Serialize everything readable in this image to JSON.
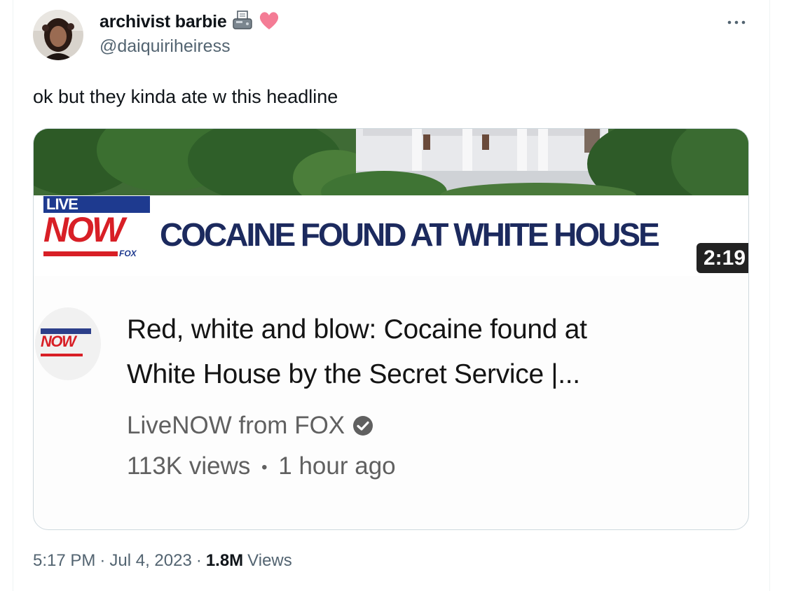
{
  "author": {
    "display_name": "archivist barbie",
    "handle": "@daiquiriheiress",
    "name_emojis": [
      "fax-machine-icon",
      "pink-heart-icon"
    ]
  },
  "menu_icon": "more-horizontal-icon",
  "tweet": {
    "text": "ok but they kinda ate w this headline"
  },
  "card": {
    "thumbnail": {
      "logo_live": "LIVE",
      "logo_now": "NOW",
      "logo_fox": "FOX",
      "headline": "COCAINE FOUND AT WHITE HOUSE",
      "duration": "2:19"
    },
    "channel_avatar_text": "NOW",
    "video_title_line1": "Red, white and blow: Cocaine found at",
    "video_title_line2": "White House by the Secret Service |...",
    "channel_name": "LiveNOW from FOX",
    "views": "113K views",
    "separator": "•",
    "age": "1 hour ago"
  },
  "footer": {
    "time": "5:17 PM",
    "dot1": "·",
    "date": "Jul 4, 2023",
    "dot2": "·",
    "views_count": "1.8M",
    "views_label": "Views"
  },
  "colors": {
    "text_primary": "#0f1419",
    "text_secondary": "#536471",
    "fox_red": "#d81f26",
    "fox_blue": "#1e3a8f"
  }
}
